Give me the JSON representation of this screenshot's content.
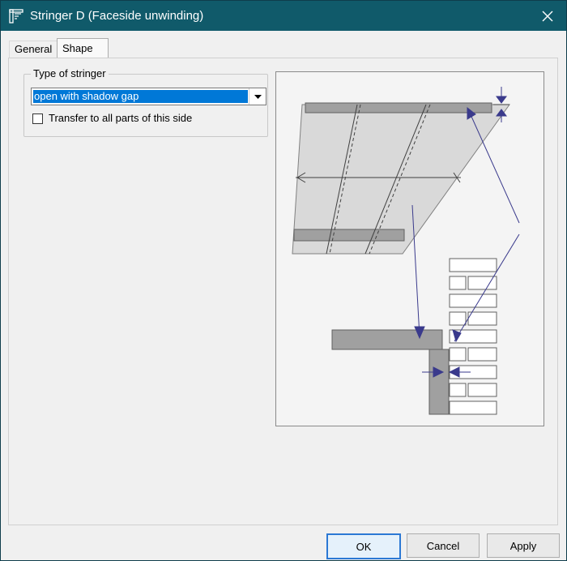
{
  "window": {
    "title": "Stringer D (Faceside unwinding)"
  },
  "icons": {
    "app": "stringer-app-icon",
    "close": "close-icon",
    "dropdown": "chevron-down-icon"
  },
  "tabs": [
    {
      "label": "General",
      "selected": false
    },
    {
      "label": "Shape",
      "selected": true
    }
  ],
  "group": {
    "legend": "Type of stringer",
    "select_value": "open with shadow gap",
    "checkbox_label": "Transfer to all parts of this side",
    "checkbox_checked": false
  },
  "buttons": {
    "ok": "OK",
    "cancel": "Cancel",
    "apply": "Apply"
  },
  "colors": {
    "titlebar": "#105a6a",
    "selection": "#0078d7",
    "arrow": "#3a3a8c",
    "stringer": "#a0a0a0"
  }
}
